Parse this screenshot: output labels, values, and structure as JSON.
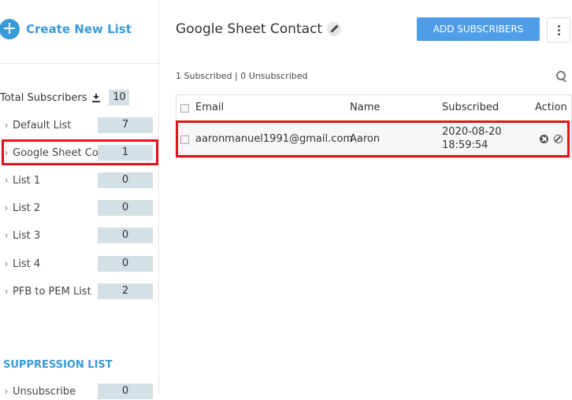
{
  "sidebar": {
    "create_label": "Create New List",
    "total_label": "Total Subscribers",
    "total_count": "10",
    "lists": [
      {
        "label": "Default List",
        "count": "7"
      },
      {
        "label": "Google Sheet Contact",
        "count": "1"
      },
      {
        "label": "List 1",
        "count": "0"
      },
      {
        "label": "List 2",
        "count": "0"
      },
      {
        "label": "List 3",
        "count": "0"
      },
      {
        "label": "List 4",
        "count": "0"
      },
      {
        "label": "PFB to PEM List",
        "count": "2"
      }
    ],
    "suppression_title": "SUPPRESSION LIST",
    "suppression_items": [
      {
        "label": "Unsubscribe",
        "count": "0"
      }
    ]
  },
  "main": {
    "title": "Google Sheet Contact",
    "add_button": "ADD SUBSCRIBERS",
    "status_text": "1 Subscribed | 0 Unsubscribed",
    "table": {
      "headers": {
        "email": "Email",
        "name": "Name",
        "subscribed": "Subscribed",
        "action": "Action"
      },
      "rows": [
        {
          "email": "aaronmanuel1991@gmail.com",
          "name": "Aaron",
          "date": "2020-08-20",
          "time": "18:59:54"
        }
      ]
    }
  },
  "colors": {
    "accent": "#3a9ad9",
    "button": "#4e9de8",
    "highlight": "#e0121b",
    "badge": "#d3e0e6"
  }
}
